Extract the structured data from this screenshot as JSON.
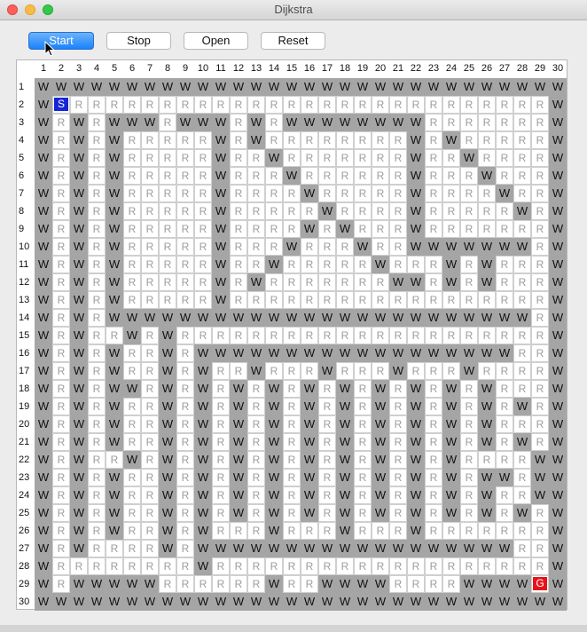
{
  "window": {
    "title": "Dijkstra"
  },
  "toolbar": {
    "start_label": "Start",
    "stop_label": "Stop",
    "open_label": "Open",
    "reset_label": "Reset"
  },
  "colors": {
    "wall": "#a5a5a5",
    "road": "#ffffff",
    "start": "#1426d4",
    "goal": "#e5141a",
    "accent": "#1a82fb"
  },
  "grid": {
    "columns": [
      "1",
      "2",
      "3",
      "4",
      "5",
      "6",
      "7",
      "8",
      "9",
      "10",
      "11",
      "12",
      "13",
      "14",
      "15",
      "16",
      "17",
      "18",
      "19",
      "20",
      "21",
      "22",
      "23",
      "24",
      "25",
      "26",
      "27",
      "28",
      "29",
      "30"
    ],
    "rows": [
      "1",
      "2",
      "3",
      "4",
      "5",
      "6",
      "7",
      "8",
      "9",
      "10",
      "11",
      "12",
      "13",
      "14",
      "15",
      "16",
      "17",
      "18",
      "19",
      "20",
      "21",
      "22",
      "23",
      "24",
      "25",
      "26",
      "27",
      "28",
      "29",
      "30"
    ],
    "legend": {
      "W": "W",
      "R": "R",
      "S": "S",
      "G": "G"
    },
    "cells": [
      "WWWWWWWWWWWWWWWWWWWWWWWWWWWWWW",
      "WSRRRRRRRRRRRRRRRRRRRRRRRRRRRW",
      "WRWRWWWRWWWRWRWWWWWWWWRRRRRRRW",
      "WRWRWRRRRRWRWRRRRRRRRWRWRRRRRW",
      "WRWRWRRRRRWRRWRRRRRRRWRRWRRRRW",
      "WRWRWRRRRRWRRRWRRRRRRWRRRWRRRW",
      "WRWRWRRRRRWRRRRWRRRRRWRRRRWRRW",
      "WRWRWRRRRRWRRRRRWRRRRWRRRRRWRW",
      "WRWRWRRRRRWRRRRWRWRRRWRRRRRRRW",
      "WRWRWRRRRRWRRRWRRRWRRWWWWWWWRW",
      "WRWRWRRRRRWRRWRRRRRWRRRWRWRRRW",
      "WRWRWRRRRRWRWRRRRRRRWWRWRWRRRW",
      "WRWRWRRRRRWRRRRRRRRRRRRRRRRRRW",
      "WRWRWWWWWWWWWWWWWWWWWWWWWWWWRW",
      "WRWRRWRWRRRRRRRRRRRRRRRRRRRRRW",
      "WRWRWRRWRWWWWWWWWWWWWWWWWWWRRW",
      "WRWRWRRWRWRRWRRRWRRRWRRRWRRRRW",
      "WRWRWWRWRWRWRWRWRWRWRWRWRWRRRW",
      "WRWRWRRWRWRWRWRWRWRWRWRWRWRWRW",
      "WRWRWRRWRWRWRWRWRWRWRWRWRWRRRW",
      "WRWRWRRWRWRWRWRWRWRWRWRWRWRWRW",
      "WRWRRWRWRWRWRWRWRWRWRWRWRRRRWW",
      "WRWRWRRWRWRWRWRWRWRWRWRWRWWRWW",
      "WRWRWRRWRWRWRWRWRWRWRWRWRWRRWW",
      "WRWRWRRWRWRWRWRWRWRWRWRWRWRWRW",
      "WRWRWRRWRWRRRWRRRWRRRWRRRRRRRW",
      "WRWRRRRWRWWWWWWWWWWWWWWWWWWRRW",
      "WRRRRRRRRWRRRRRRRRRRRRRRRRRRRW",
      "WRWWWWWRRRRRRWRRWWWWRRRRWWWWGW",
      "WWWWWWWWWWWWWWWWWWWWWWWWWWWWWW"
    ]
  }
}
